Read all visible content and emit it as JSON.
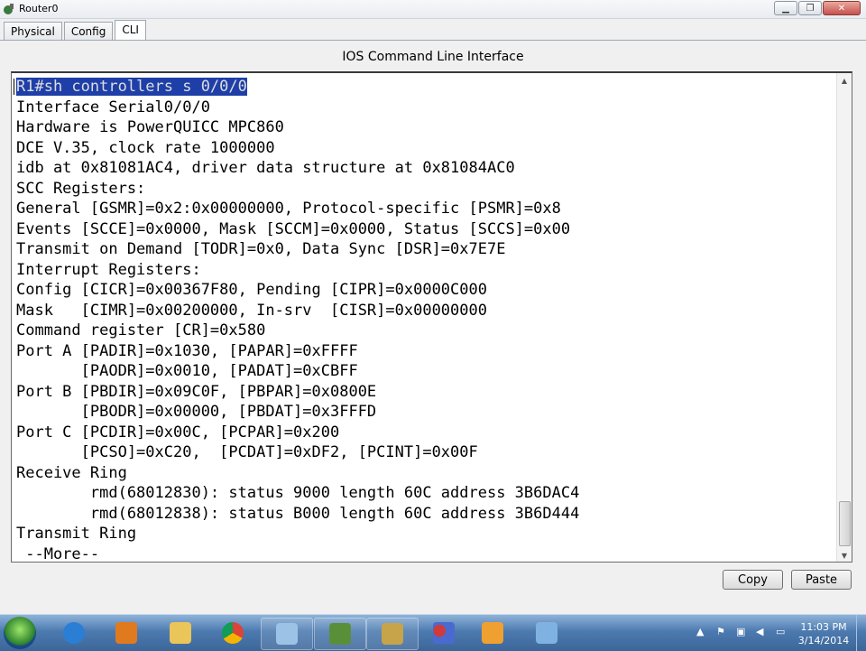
{
  "window": {
    "title": "Router0"
  },
  "tabs": [
    {
      "label": "Physical",
      "active": false
    },
    {
      "label": "Config",
      "active": false
    },
    {
      "label": "CLI",
      "active": true
    }
  ],
  "cli": {
    "heading": "IOS Command Line Interface",
    "command_line": "R1#sh controllers s 0/0/0",
    "output": "\nInterface Serial0/0/0\nHardware is PowerQUICC MPC860\nDCE V.35, clock rate 1000000\nidb at 0x81081AC4, driver data structure at 0x81084AC0\nSCC Registers:\nGeneral [GSMR]=0x2:0x00000000, Protocol-specific [PSMR]=0x8\nEvents [SCCE]=0x0000, Mask [SCCM]=0x0000, Status [SCCS]=0x00\nTransmit on Demand [TODR]=0x0, Data Sync [DSR]=0x7E7E\nInterrupt Registers:\nConfig [CICR]=0x00367F80, Pending [CIPR]=0x0000C000\nMask   [CIMR]=0x00200000, In-srv  [CISR]=0x00000000\nCommand register [CR]=0x580\nPort A [PADIR]=0x1030, [PAPAR]=0xFFFF\n       [PAODR]=0x0010, [PADAT]=0xCBFF\nPort B [PBDIR]=0x09C0F, [PBPAR]=0x0800E\n       [PBODR]=0x00000, [PBDAT]=0x3FFFD\nPort C [PCDIR]=0x00C, [PCPAR]=0x200\n       [PCSO]=0xC20,  [PCDAT]=0xDF2, [PCINT]=0x00F\nReceive Ring\n        rmd(68012830): status 9000 length 60C address 3B6DAC4\n        rmd(68012838): status B000 length 60C address 3B6D444\nTransmit Ring\n --More--",
    "highlight_color": "#1e3fa8"
  },
  "buttons": {
    "copy": "Copy",
    "paste": "Paste"
  },
  "taskbar": {
    "items": [
      {
        "icon": "internet-explorer-icon",
        "color": "#2a7fd4"
      },
      {
        "icon": "media-player-icon",
        "color": "#e07a1f"
      },
      {
        "icon": "file-explorer-icon",
        "color": "#e9c55a"
      },
      {
        "icon": "chrome-icon",
        "color": "#db4437"
      },
      {
        "icon": "notepad-icon",
        "color": "#9cc3e6"
      },
      {
        "icon": "packet-tracer-icon",
        "color": "#5a8f3a"
      },
      {
        "icon": "router-app-icon",
        "color": "#c7a34a"
      },
      {
        "icon": "molecule-app-icon",
        "color": "#d03a3a"
      },
      {
        "icon": "cisco-app-icon",
        "color": "#f0a030"
      },
      {
        "icon": "paint-icon",
        "color": "#7fb2e0"
      }
    ],
    "clock_time": "11:03 PM",
    "clock_date": "3/14/2014"
  }
}
